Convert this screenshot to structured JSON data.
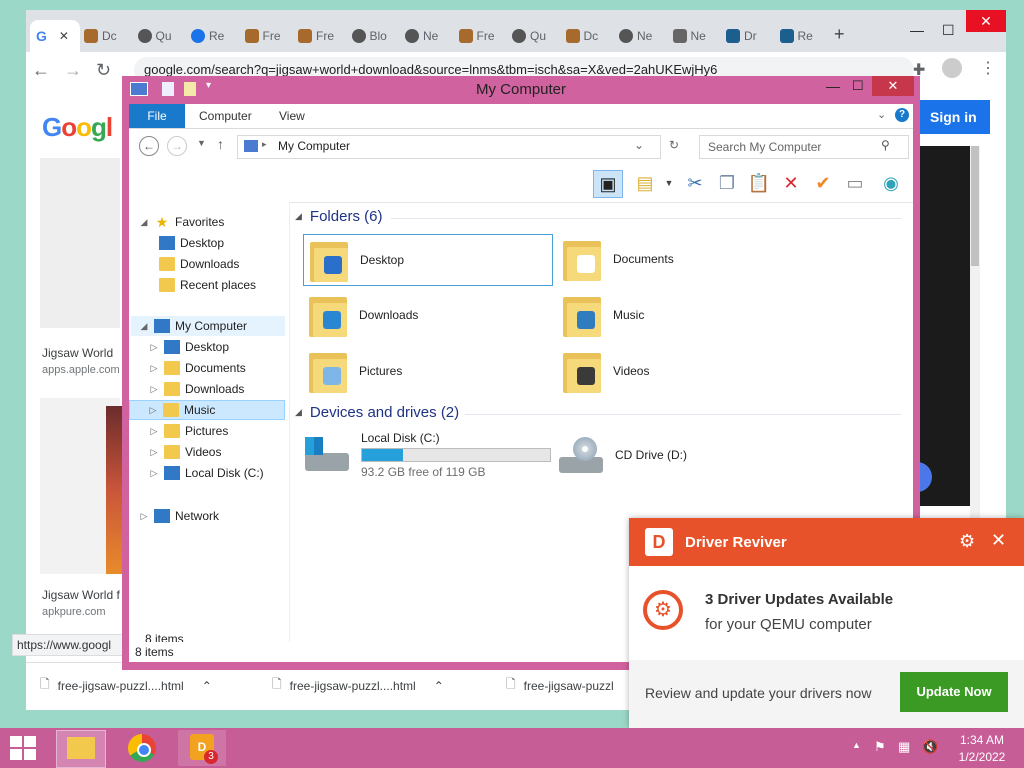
{
  "chrome": {
    "tabs": [
      {
        "label": "",
        "icon": "google-icon",
        "active": true
      },
      {
        "label": "Dc",
        "icon": "jigsaw-icon"
      },
      {
        "label": "Qu",
        "icon": "globe-icon"
      },
      {
        "label": "Re",
        "icon": "loading-icon"
      },
      {
        "label": "Fre",
        "icon": "jigsaw-icon"
      },
      {
        "label": "Fre",
        "icon": "jigsaw-icon"
      },
      {
        "label": "Blo",
        "icon": "globe-icon"
      },
      {
        "label": "Ne",
        "icon": "globe-icon"
      },
      {
        "label": "Fre",
        "icon": "jigsaw-icon"
      },
      {
        "label": "Qu",
        "icon": "globe-icon"
      },
      {
        "label": "Dc",
        "icon": "jigsaw-icon"
      },
      {
        "label": "Ne",
        "icon": "globe-icon"
      },
      {
        "label": "Ne",
        "icon": "search-icon"
      },
      {
        "label": "Dr",
        "icon": "driver-icon"
      },
      {
        "label": "Re",
        "icon": "driver-icon"
      }
    ],
    "new_tab": "+",
    "url": "google.com/search?q=jigsaw+world+download&source=lnms&tbm=isch&sa=X&ved=2ahUKEwjHy6",
    "sign_in": "Sign in",
    "results": [
      {
        "title": "Jigsaw World",
        "source": "apps.apple.com"
      },
      {
        "title": "Jigsaw World f",
        "source": "apkpure.com"
      }
    ],
    "status_url": "https://www.googl",
    "downloads": [
      "free-jigsaw-puzzl....html",
      "free-jigsaw-puzzl....html",
      "free-jigsaw-puzzl"
    ]
  },
  "explorer": {
    "title": "My Computer",
    "ribbon_tabs": [
      "File",
      "Computer",
      "View"
    ],
    "address": "My Computer",
    "search_placeholder": "Search My Computer",
    "nav": {
      "favorites_label": "Favorites",
      "favorites": [
        "Desktop",
        "Downloads",
        "Recent places"
      ],
      "computer_label": "My Computer",
      "computer_items": [
        "Desktop",
        "Documents",
        "Downloads",
        "Music",
        "Pictures",
        "Videos",
        "Local Disk (C:)"
      ],
      "network_label": "Network"
    },
    "folders_header": "Folders (6)",
    "folders": [
      "Desktop",
      "Documents",
      "Downloads",
      "Music",
      "Pictures",
      "Videos"
    ],
    "devices_header": "Devices and drives (2)",
    "drives": [
      {
        "name": "Local Disk (C:)",
        "free_text": "93.2 GB free of 119 GB",
        "used_fraction": 0.22
      },
      {
        "name": "CD Drive (D:)"
      }
    ],
    "items_count": "8 items",
    "status_count": "8 items"
  },
  "driver_reviver": {
    "title": "Driver Reviver",
    "headline": "3 Driver Updates Available",
    "subline": "for your QEMU computer",
    "prompt": "Review and update your drivers now",
    "button": "Update Now"
  },
  "taskbar": {
    "time": "1:34 AM",
    "date": "1/2/2022",
    "badge": "3"
  },
  "colors": {
    "window_frame": "#d0629f",
    "taskbar": "#c75d97",
    "file_tab": "#1979ca",
    "popup_header": "#e8522a",
    "update_button": "#3a9a23"
  }
}
